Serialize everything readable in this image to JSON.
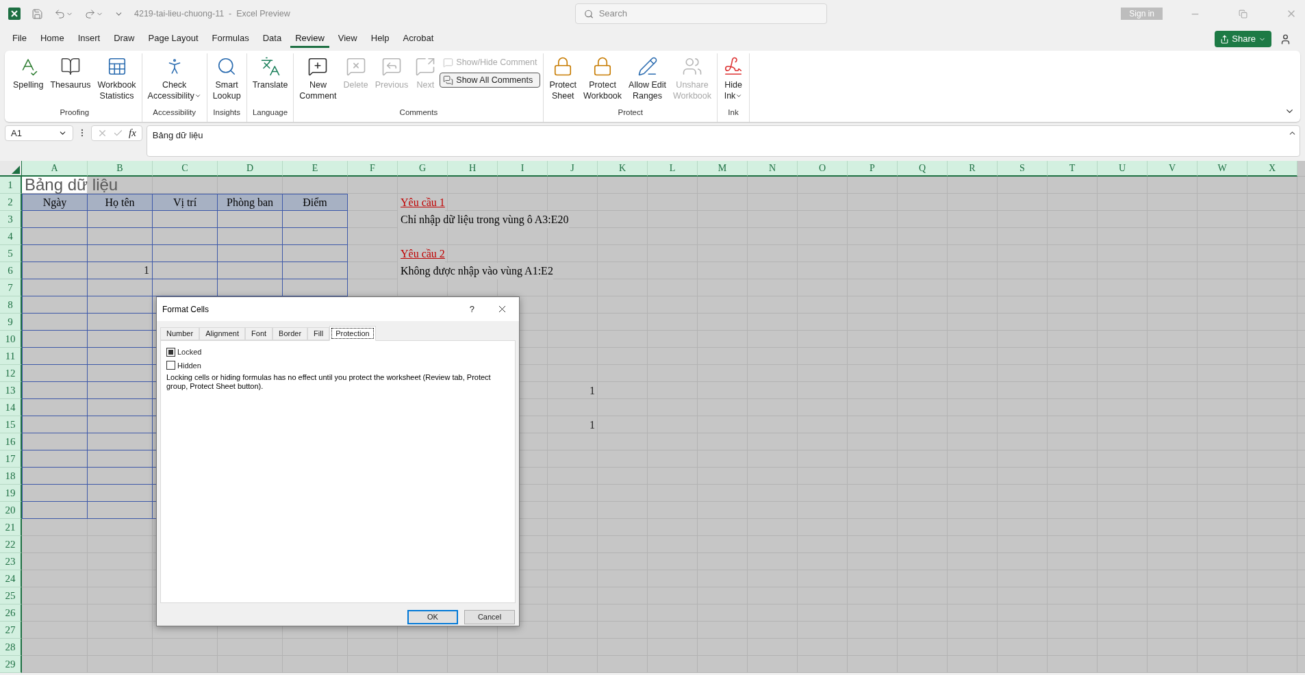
{
  "title_bar": {
    "title": "4219-tai-lieu-chuong-11  -  Excel Preview",
    "search": {
      "placeholder": "Search"
    },
    "sign_in": "Sign in"
  },
  "menu_tabs": [
    {
      "label": "File",
      "selected": false
    },
    {
      "label": "Home",
      "selected": false
    },
    {
      "label": "Insert",
      "selected": false
    },
    {
      "label": "Draw",
      "selected": false
    },
    {
      "label": "Page Layout",
      "selected": false
    },
    {
      "label": "Formulas",
      "selected": false
    },
    {
      "label": "Data",
      "selected": false
    },
    {
      "label": "Review",
      "selected": true
    },
    {
      "label": "View",
      "selected": false
    },
    {
      "label": "Help",
      "selected": false
    },
    {
      "label": "Acrobat",
      "selected": false
    }
  ],
  "share": "Share",
  "ribbon": [
    {
      "label": "Proofing",
      "buttons": [
        {
          "kind": "large",
          "lines": [
            "Spelling"
          ],
          "disabled": false,
          "dropdown": false
        },
        {
          "kind": "large",
          "lines": [
            "Thesaurus"
          ],
          "disabled": false,
          "dropdown": false
        },
        {
          "kind": "large",
          "lines": [
            "Workbook",
            "Statistics"
          ],
          "disabled": false,
          "dropdown": false
        }
      ]
    },
    {
      "label": "Accessibility",
      "buttons": [
        {
          "kind": "large",
          "lines": [
            "Check",
            "Accessibility"
          ],
          "disabled": false,
          "dropdown": true
        }
      ]
    },
    {
      "label": "Insights",
      "buttons": [
        {
          "kind": "large",
          "lines": [
            "Smart",
            "Lookup"
          ],
          "disabled": false,
          "dropdown": false
        }
      ]
    },
    {
      "label": "Language",
      "buttons": [
        {
          "kind": "large",
          "lines": [
            "Translate"
          ],
          "disabled": false,
          "dropdown": false
        }
      ]
    },
    {
      "label": "Comments",
      "buttons": [
        {
          "kind": "large",
          "lines": [
            "New",
            "Comment"
          ],
          "disabled": false,
          "dropdown": false
        },
        {
          "kind": "large",
          "lines": [
            "Delete"
          ],
          "disabled": true,
          "dropdown": false
        },
        {
          "kind": "large",
          "lines": [
            "Previous"
          ],
          "disabled": true,
          "dropdown": false
        },
        {
          "kind": "large",
          "lines": [
            "Next"
          ],
          "disabled": true,
          "dropdown": false
        },
        {
          "kind": "small",
          "label": "Show/Hide Comment",
          "disabled": true,
          "on": false
        },
        {
          "kind": "small",
          "label": "Show All Comments",
          "disabled": false,
          "on": true
        }
      ]
    },
    {
      "label": "Protect",
      "buttons": [
        {
          "kind": "large",
          "lines": [
            "Protect",
            "Sheet"
          ],
          "disabled": false,
          "dropdown": false
        },
        {
          "kind": "large",
          "lines": [
            "Protect",
            "Workbook"
          ],
          "disabled": false,
          "dropdown": false
        },
        {
          "kind": "large",
          "lines": [
            "Allow Edit",
            "Ranges"
          ],
          "disabled": false,
          "dropdown": false
        },
        {
          "kind": "large",
          "lines": [
            "Unshare",
            "Workbook"
          ],
          "disabled": true,
          "dropdown": false
        }
      ]
    },
    {
      "label": "Ink",
      "buttons": [
        {
          "kind": "large",
          "lines": [
            "Hide",
            "Ink"
          ],
          "disabled": false,
          "dropdown": true
        }
      ]
    }
  ],
  "formula_bar": {
    "name_box": "A1",
    "function_label": "fx",
    "formula": "Bảng dữ liệu"
  },
  "sheet": {
    "columns": [
      "A",
      "B",
      "C",
      "D",
      "E",
      "F",
      "G",
      "H",
      "I",
      "J",
      "K",
      "L",
      "M",
      "N",
      "O",
      "P",
      "Q",
      "R",
      "S",
      "T",
      "U",
      "V",
      "W",
      "X"
    ],
    "rows": [
      "1",
      "2",
      "3",
      "4",
      "5",
      "6",
      "7",
      "8",
      "9",
      "10",
      "11",
      "12",
      "13",
      "14",
      "15",
      "16",
      "17",
      "18",
      "19",
      "20",
      "21",
      "22",
      "23",
      "24",
      "25",
      "26",
      "27",
      "28",
      "29"
    ],
    "title_cell": "Bảng dữ liệu",
    "table_headers": [
      "Ngày",
      "Họ tên",
      "Vị trí",
      "Phòng ban",
      "Điểm"
    ],
    "table_values": [
      "1"
    ],
    "requirements": [
      {
        "heading": "Yêu cầu 1",
        "text": "Chỉ nhập dữ liệu trong vùng ô A3:E20"
      },
      {
        "heading": "Yêu cầu 2",
        "text": "Không được nhập vào vùng A1:E2"
      }
    ],
    "loose_values": [
      "1",
      "1"
    ]
  },
  "dialog": {
    "title": "Format Cells",
    "help": "?",
    "tabs": [
      {
        "label": "Number",
        "selected": false
      },
      {
        "label": "Alignment",
        "selected": false
      },
      {
        "label": "Font",
        "selected": false
      },
      {
        "label": "Border",
        "selected": false
      },
      {
        "label": "Fill",
        "selected": false
      },
      {
        "label": "Protection",
        "selected": true
      }
    ],
    "options": [
      {
        "label": "Locked",
        "checked": true
      },
      {
        "label": "Hidden",
        "checked": false
      }
    ],
    "note": "Locking cells or hiding formulas has no effect until you protect the worksheet (Review tab, Protect group, Protect Sheet button).",
    "buttons": [
      {
        "label": "OK",
        "kind": "default"
      },
      {
        "label": "Cancel",
        "kind": "normal"
      }
    ]
  }
}
